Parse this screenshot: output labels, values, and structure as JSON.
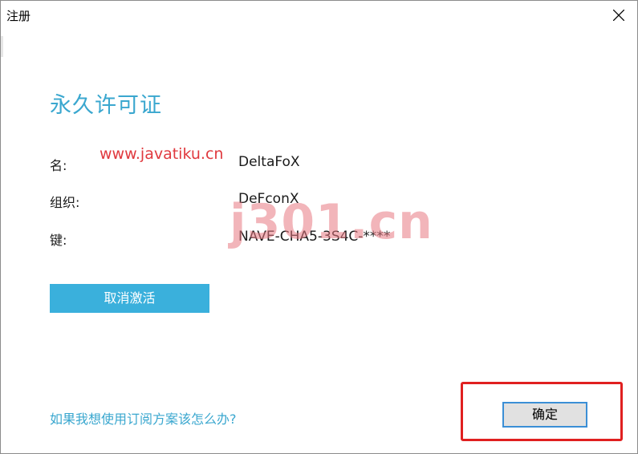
{
  "window": {
    "title": "注册"
  },
  "license": {
    "heading": "永久许可证",
    "rows": [
      {
        "label": "名:",
        "value": "DeltaFoX"
      },
      {
        "label": "组织:",
        "value": "DeFconX"
      },
      {
        "label": "键:",
        "value": "NAVE-CHA5-3S4C-****"
      }
    ]
  },
  "watermarks": {
    "site_url": "www.javatiku.cn",
    "brand": "j301.cn"
  },
  "buttons": {
    "deactivate_label": "取消激活",
    "ok_label": "确定"
  },
  "links": {
    "subscription_label": "如果我想使用订阅方案该怎么办?"
  },
  "colors": {
    "accent": "#3aa7cf",
    "button_blue": "#3ab0dc",
    "highlight_red": "#e02020"
  }
}
